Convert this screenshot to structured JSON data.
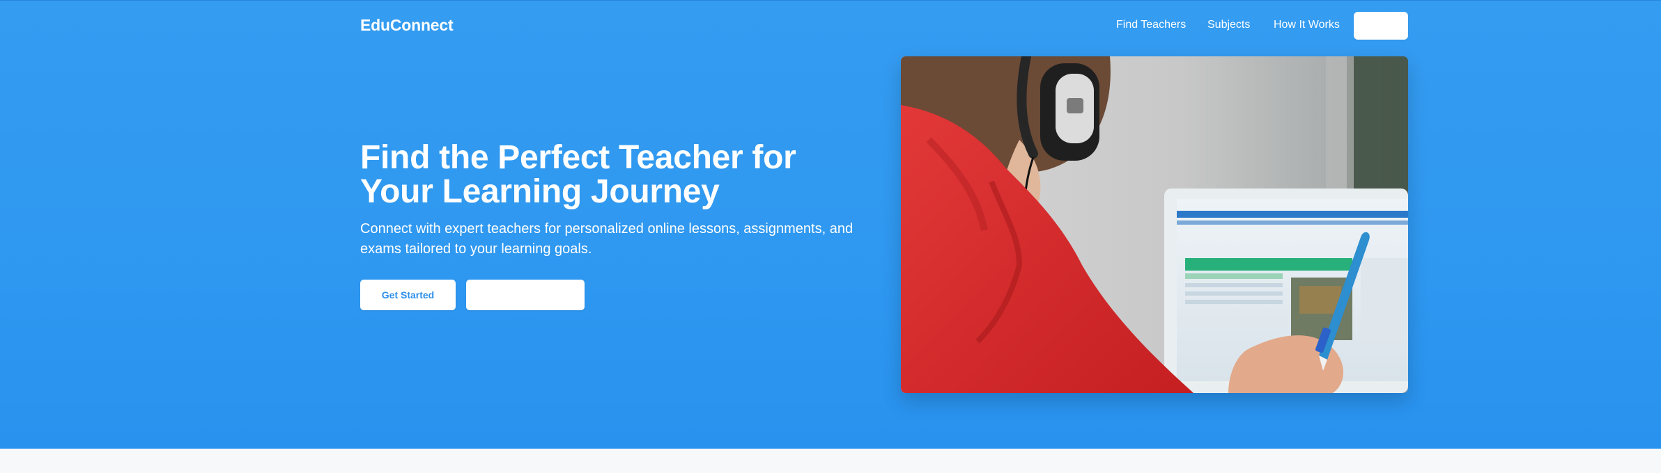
{
  "nav": {
    "logo": "EduConnect",
    "links": [
      "Find Teachers",
      "Subjects",
      "How It Works"
    ],
    "cta_label": ""
  },
  "hero": {
    "title": "Find the Perfect Teacher for Your Learning Journey",
    "subtitle": "Connect with expert teachers for personalized online lessons, assignments, and exams tailored to your learning goals.",
    "primary_button": "Get Started",
    "secondary_button": ""
  },
  "image": {
    "description_icon": "student-photo"
  },
  "colors": {
    "hero_bg": "#2f98f0",
    "primary_text": "#2f8fea",
    "white": "#ffffff"
  }
}
